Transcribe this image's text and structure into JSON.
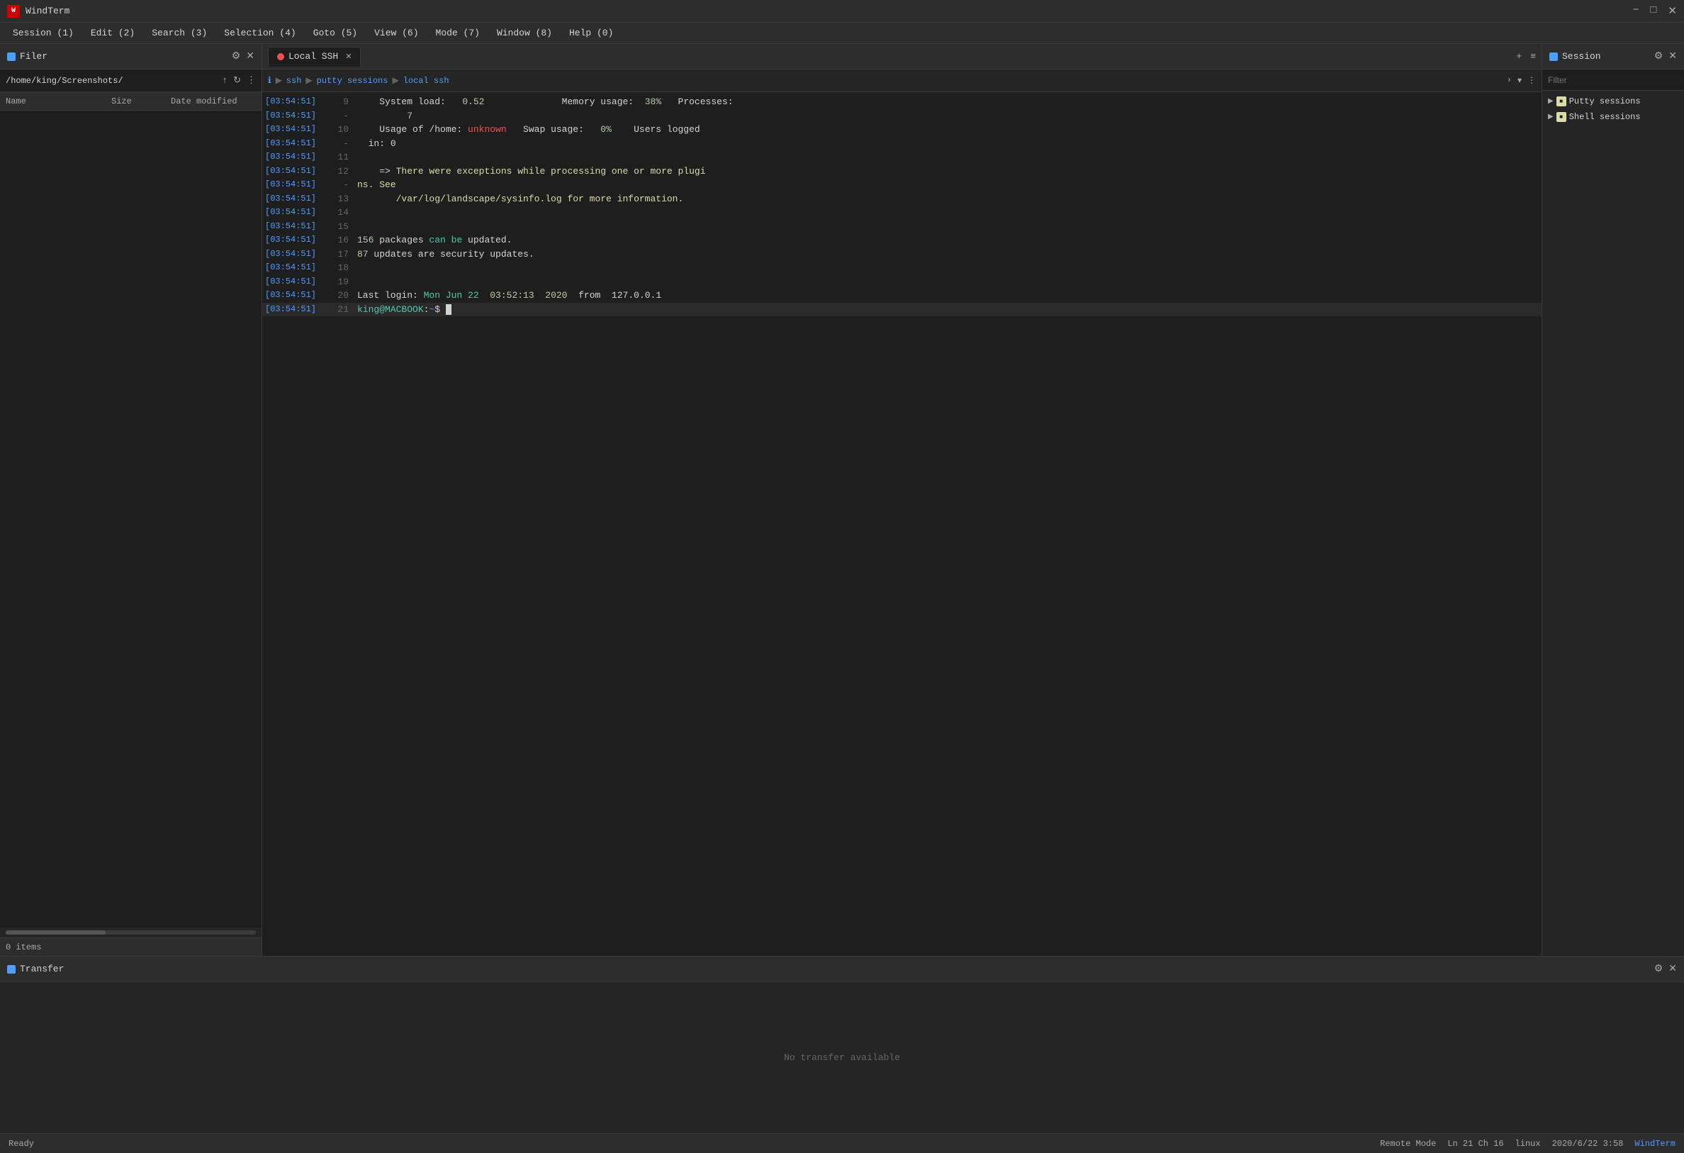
{
  "titlebar": {
    "icon": "W",
    "title": "WindTerm",
    "minimize": "−",
    "maximize": "□",
    "close": "✕"
  },
  "menu": {
    "items": [
      "Session (1)",
      "Edit (2)",
      "Search (3)",
      "Selection (4)",
      "Goto (5)",
      "View (6)",
      "Mode (7)",
      "Window (8)",
      "Help (0)"
    ]
  },
  "filer": {
    "title": "Filer",
    "path": "/home/king/Screenshots/",
    "columns": {
      "name": "Name",
      "size": "Size",
      "date": "Date modified"
    },
    "status": "0 items",
    "settings_icon": "⚙",
    "close_icon": "✕"
  },
  "terminal": {
    "tab_label": "Local SSH",
    "tab_close": "✕",
    "tab_plus": "+",
    "tab_menu": "≡",
    "breadcrumb": {
      "ssh": "ssh",
      "putty_sessions": "putty sessions",
      "local_ssh": "local ssh"
    },
    "lines": [
      {
        "time": "[03:54:51]",
        "num": "9",
        "content": "    System load:   0.52              Memory usage:  38%   Processes:"
      },
      {
        "time": "[03:54:51]",
        "num": "-",
        "content": "         7"
      },
      {
        "time": "[03:54:51]",
        "num": "10",
        "content": "    Usage of /home: unknown   Swap usage:   0%    Users logged "
      },
      {
        "time": "[03:54:51]",
        "num": "-",
        "content": "  in: 0"
      },
      {
        "time": "[03:54:51]",
        "num": "11",
        "content": ""
      },
      {
        "time": "[03:54:51]",
        "num": "12",
        "content": "    => There were exceptions while processing one or more plugi"
      },
      {
        "time": "[03:54:51]",
        "num": "-",
        "content": "ns. See"
      },
      {
        "time": "[03:54:51]",
        "num": "13",
        "content": "       /var/log/landscape/sysinfo.log for more information."
      },
      {
        "time": "[03:54:51]",
        "num": "14",
        "content": ""
      },
      {
        "time": "[03:54:51]",
        "num": "15",
        "content": ""
      },
      {
        "time": "[03:54:51]",
        "num": "16",
        "content": "156 packages can be updated."
      },
      {
        "time": "[03:54:51]",
        "num": "17",
        "content": "87 updates are security updates."
      },
      {
        "time": "[03:54:51]",
        "num": "18",
        "content": ""
      },
      {
        "time": "[03:54:51]",
        "num": "19",
        "content": ""
      },
      {
        "time": "[03:54:51]",
        "num": "20",
        "content": "Last login: Mon Jun 22  03:52:13  2020  from  127.0.0.1"
      },
      {
        "time": "[03:54:51]",
        "num": "21",
        "content": "king@MACBOOK:~$ "
      }
    ]
  },
  "session": {
    "title": "Session",
    "filter_placeholder": "Filter",
    "settings_icon": "⚙",
    "close_icon": "✕",
    "tree": [
      {
        "label": "Putty sessions",
        "type": "folder"
      },
      {
        "label": "Shell sessions",
        "type": "folder"
      }
    ]
  },
  "transfer": {
    "title": "Transfer",
    "empty_text": "No transfer available",
    "settings_icon": "⚙",
    "close_icon": "✕"
  },
  "statusbar": {
    "ready": "Ready",
    "remote_mode": "Remote Mode",
    "position": "Ln 21 Ch 16",
    "os": "linux",
    "datetime": "2020/6/22  3:58",
    "brand": "WindTerm"
  }
}
